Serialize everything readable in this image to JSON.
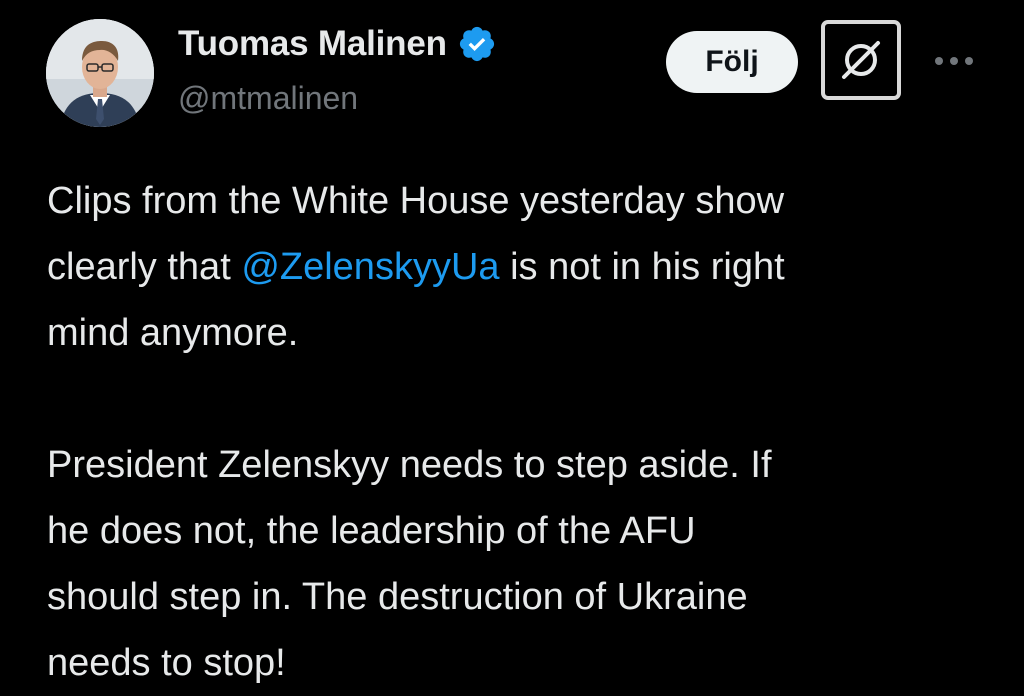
{
  "author": {
    "display_name": "Tuomas Malinen",
    "handle": "@mtmalinen",
    "verified_badge_icon": "verified-badge-icon",
    "avatar_icon": "profile-photo"
  },
  "actions": {
    "follow_label": "Följ",
    "grok_icon": "grok-icon",
    "more_icon": "more-options-icon"
  },
  "tweet": {
    "line1": "Clips from the White House yesterday show",
    "line2_before": "clearly that ",
    "line2_mention": "@ZelenskyyUa",
    "line2_after": " is not in his right",
    "line3": "mind anymore.",
    "line4": "President Zelenskyy needs to step aside. If",
    "line5": "he does not, the leadership of the AFU",
    "line6": "should step in. The destruction of Ukraine",
    "line7": "needs to stop!"
  },
  "colors": {
    "background": "#000000",
    "text": "#e7e9ea",
    "secondary_text": "#71767b",
    "mention": "#1d9bf0",
    "verified_badge": "#1d9bf0",
    "follow_button_bg": "#eff3f4"
  }
}
